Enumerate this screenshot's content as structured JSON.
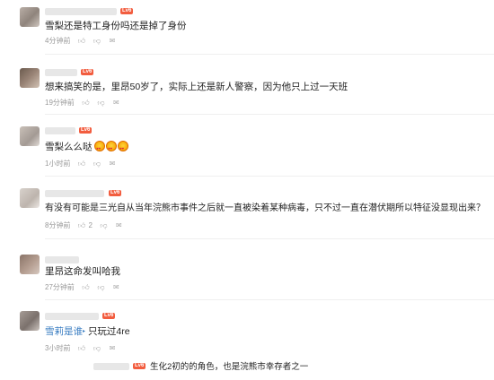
{
  "comments": [
    {
      "text": "雪梨还是特工身份吗还是掉了身份",
      "time": "4分钟前",
      "likes": ""
    },
    {
      "text": "想来搞笑的是，里昂50岁了，实际上还是新人警察，因为他只上过一天班",
      "time": "19分钟前",
      "likes": ""
    },
    {
      "text": "雪梨么么哒",
      "time": "1小时前",
      "likes": ""
    },
    {
      "text": "有没有可能是三光自从当年浣熊市事件之后就一直被染着某种病毒，只不过一直在潜伏期所以特征没显现出来？",
      "time": "8分钟前",
      "likes": "2"
    },
    {
      "text": "里昂这命发叫哈我",
      "time": "27分钟前",
      "likes": ""
    },
    {
      "reply_name": "雪莉是谁",
      "text": "只玩过4re",
      "time": "3小时前",
      "likes": ""
    },
    {
      "text": "生化2初的的角色，也是浣熊市幸存者之一"
    }
  ],
  "level_badge": "Lv6",
  "icons": [
    "thumb-up-icon",
    "thumb-down-icon",
    "reply-icon"
  ]
}
